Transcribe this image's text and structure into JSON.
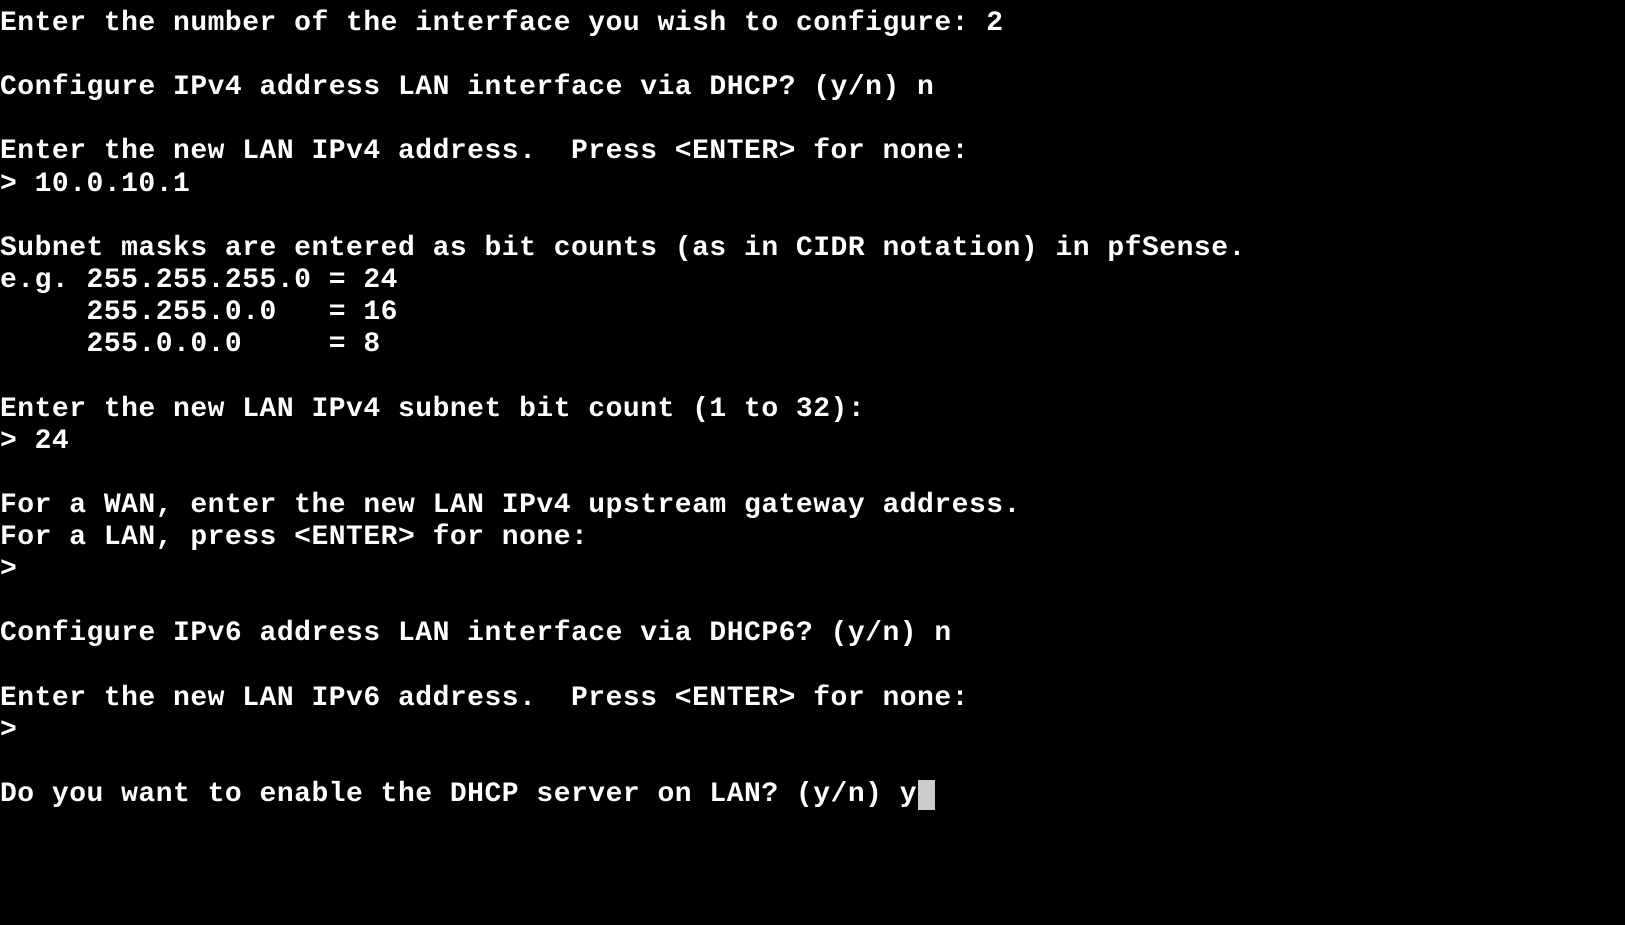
{
  "terminal": {
    "lines": [
      {
        "text": "Enter the number of the interface you wish to configure: ",
        "input": "2",
        "interactable": false
      },
      {
        "text": "",
        "interactable": false
      },
      {
        "text": "Configure IPv4 address LAN interface via DHCP? (y/n) ",
        "input": "n",
        "interactable": false
      },
      {
        "text": "",
        "interactable": false
      },
      {
        "text": "Enter the new LAN IPv4 address.  Press <ENTER> for none:",
        "interactable": false
      },
      {
        "text": "> ",
        "input": "10.0.10.1",
        "interactable": false
      },
      {
        "text": "",
        "interactable": false
      },
      {
        "text": "Subnet masks are entered as bit counts (as in CIDR notation) in pfSense.",
        "interactable": false
      },
      {
        "text": "e.g. 255.255.255.0 = 24",
        "interactable": false
      },
      {
        "text": "     255.255.0.0   = 16",
        "interactable": false
      },
      {
        "text": "     255.0.0.0     = 8",
        "interactable": false
      },
      {
        "text": "",
        "interactable": false
      },
      {
        "text": "Enter the new LAN IPv4 subnet bit count (1 to 32):",
        "interactable": false
      },
      {
        "text": "> ",
        "input": "24",
        "interactable": false
      },
      {
        "text": "",
        "interactable": false
      },
      {
        "text": "For a WAN, enter the new LAN IPv4 upstream gateway address.",
        "interactable": false
      },
      {
        "text": "For a LAN, press <ENTER> for none:",
        "interactable": false
      },
      {
        "text": "> ",
        "input": "",
        "interactable": false
      },
      {
        "text": "",
        "interactable": false
      },
      {
        "text": "Configure IPv6 address LAN interface via DHCP6? (y/n) ",
        "input": "n",
        "interactable": false
      },
      {
        "text": "",
        "interactable": false
      },
      {
        "text": "Enter the new LAN IPv6 address.  Press <ENTER> for none:",
        "interactable": false
      },
      {
        "text": "> ",
        "input": "",
        "interactable": false
      },
      {
        "text": "",
        "interactable": false
      },
      {
        "text": "Do you want to enable the DHCP server on LAN? (y/n) ",
        "input": "y",
        "cursor": true,
        "interactable": true
      }
    ]
  }
}
